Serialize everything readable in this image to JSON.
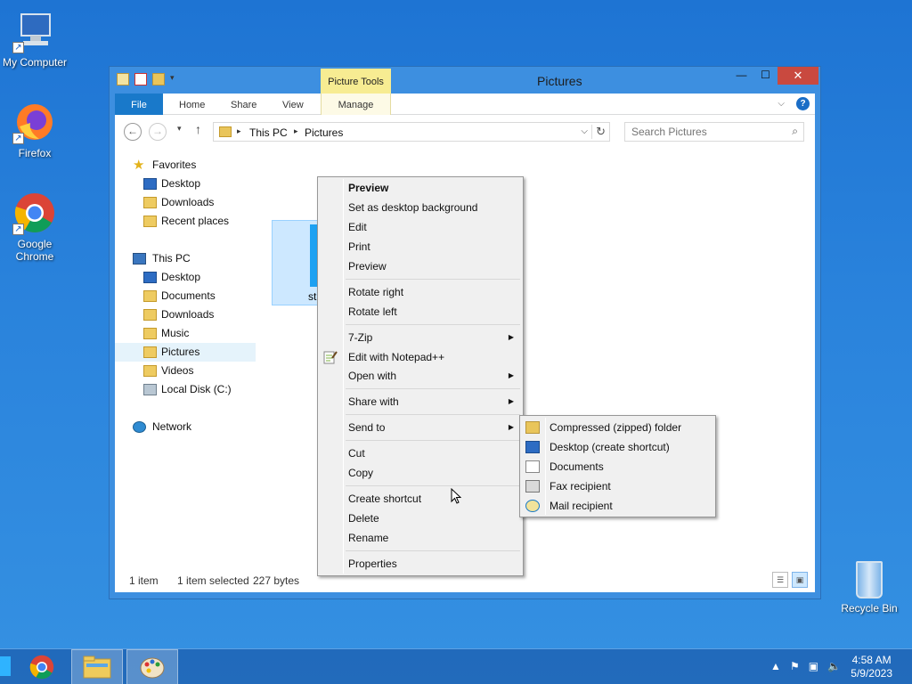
{
  "desktop": {
    "icons": [
      {
        "label": "My Computer"
      },
      {
        "label": "Firefox"
      },
      {
        "label": "Google Chrome"
      },
      {
        "label": "Recycle Bin"
      }
    ]
  },
  "window": {
    "title": "Pictures",
    "context_tab": "Picture Tools",
    "ribbon_tabs": [
      "File",
      "Home",
      "Share",
      "View",
      "Manage"
    ],
    "address": {
      "crumbs": [
        "This PC",
        "Pictures"
      ]
    },
    "search": {
      "placeholder": "Search Pictures"
    },
    "nav": {
      "favorites": "Favorites",
      "favorites_items": [
        "Desktop",
        "Downloads",
        "Recent places"
      ],
      "this_pc": "This PC",
      "this_pc_items": [
        "Desktop",
        "Documents",
        "Downloads",
        "Music",
        "Pictures",
        "Videos",
        "Local Disk (C:)"
      ],
      "network": "Network"
    },
    "file": {
      "name": "sta"
    },
    "status": {
      "count": "1 item",
      "selected": "1 item selected",
      "size": "227 bytes"
    }
  },
  "context_menu": {
    "preview_bold": "Preview",
    "set_bg": "Set as desktop background",
    "edit": "Edit",
    "print": "Print",
    "preview": "Preview",
    "rotate_right": "Rotate right",
    "rotate_left": "Rotate left",
    "zip": "7-Zip",
    "notepad": "Edit with Notepad++",
    "open_with": "Open with",
    "share_with": "Share with",
    "send_to": "Send to",
    "cut": "Cut",
    "copy": "Copy",
    "create_shortcut": "Create shortcut",
    "delete": "Delete",
    "rename": "Rename",
    "properties": "Properties"
  },
  "send_to_menu": {
    "items": [
      "Compressed (zipped) folder",
      "Desktop (create shortcut)",
      "Documents",
      "Fax recipient",
      "Mail recipient"
    ]
  },
  "taskbar": {
    "time": "4:58 AM",
    "date": "5/9/2023"
  },
  "colors": {
    "desktop": "#2a83dc",
    "title_close": "#c9493f",
    "file_tab": "#1979ca",
    "context_tab": "#f7ec92",
    "selection": "#cde8ff"
  }
}
